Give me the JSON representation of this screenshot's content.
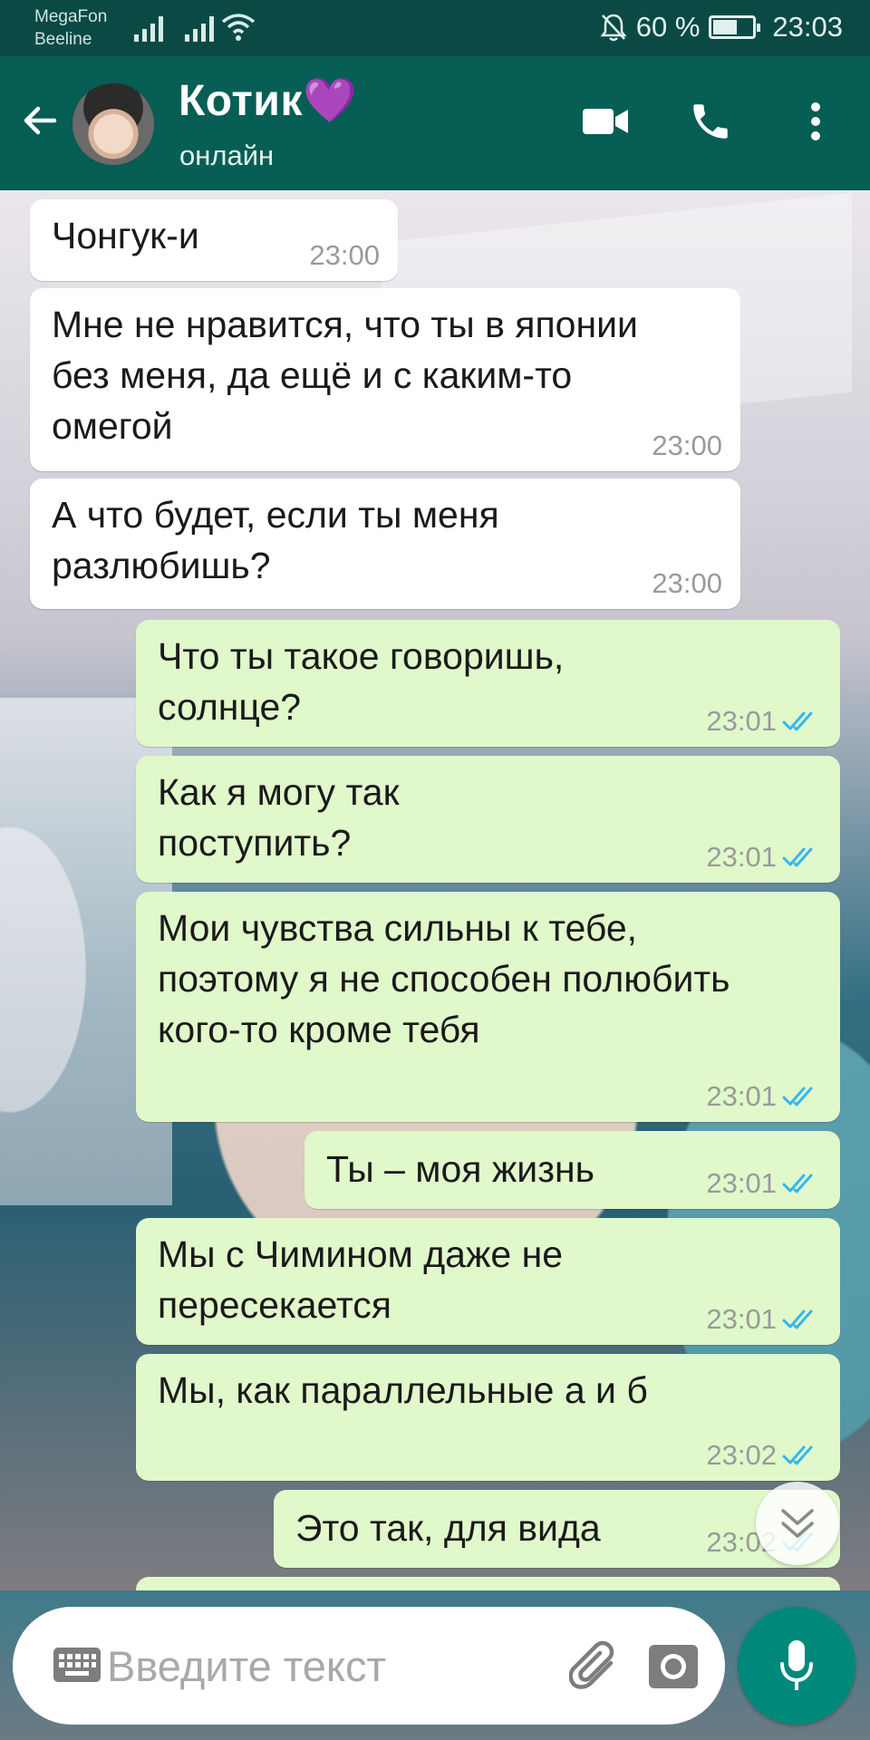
{
  "status_bar": {
    "carrier1": "MegaFon",
    "carrier2": "Beeline",
    "battery_percent": "60 %",
    "battery_level": 0.6,
    "time": "23:03"
  },
  "header": {
    "contact_name": "Котик💜",
    "contact_status": "онлайн"
  },
  "messages": [
    {
      "direction": "in",
      "text": "Чонгук-и",
      "time": "23:00"
    },
    {
      "direction": "in",
      "text": "Мне не нравится, что ты в японии без меня, да ещё и с каким-то омегой",
      "time": "23:00"
    },
    {
      "direction": "in",
      "text": "А что будет, если ты меня разлюбишь?",
      "time": "23:00"
    },
    {
      "direction": "out",
      "text": "Что ты такое говоришь, солнце?",
      "time": "23:01",
      "read": true
    },
    {
      "direction": "out",
      "text": "Как я могу так поступить?",
      "time": "23:01",
      "read": true
    },
    {
      "direction": "out",
      "text": "Мои чувства сильны к тебе, поэтому я не способен полюбить кого-то кроме тебя",
      "time": "23:01",
      "read": true
    },
    {
      "direction": "out",
      "text": "Ты – моя жизнь",
      "time": "23:01",
      "read": true
    },
    {
      "direction": "out",
      "text": "Мы с Чимином даже не пересекается",
      "time": "23:01",
      "read": true
    },
    {
      "direction": "out",
      "text": "Мы, как параллельные а и б",
      "time": "23:02",
      "read": true
    },
    {
      "direction": "out",
      "text": "Это так, для вида",
      "time": "23:02",
      "read": true
    }
  ],
  "input": {
    "placeholder": "Введите текст"
  },
  "colors": {
    "header": "#075e54",
    "status_bar": "#0b4a44",
    "bubble_in": "#ffffff",
    "bubble_out": "#e1f8cb",
    "tick_read": "#34b7f1",
    "mic_button": "#00897b"
  }
}
